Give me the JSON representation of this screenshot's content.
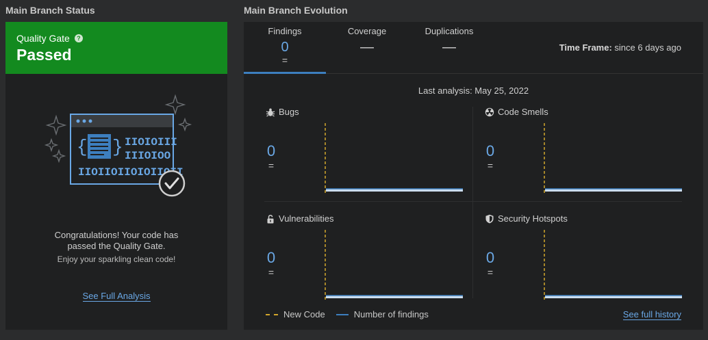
{
  "left": {
    "title": "Main Branch Status",
    "quality_gate_label": "Quality Gate",
    "help_glyph": "?",
    "status": "Passed",
    "status_color": "#138a1f",
    "congrats_line1": "Congratulations! Your code has",
    "congrats_line2": "passed the Quality Gate.",
    "enjoy": "Enjoy your sparkling clean code!",
    "see_full_analysis": "See Full Analysis"
  },
  "right": {
    "title": "Main Branch Evolution",
    "tabs": [
      {
        "label": "Findings",
        "value": "0",
        "eq": "=",
        "active": true
      },
      {
        "label": "Coverage",
        "value": "—",
        "active": false
      },
      {
        "label": "Duplications",
        "value": "—",
        "active": false
      }
    ],
    "timeframe_label": "Time Frame:",
    "timeframe_value": "since 6 days ago",
    "last_analysis": "Last analysis: May 25, 2022",
    "metrics": [
      {
        "name": "Bugs",
        "icon": "bug-icon",
        "value": "0",
        "eq": "="
      },
      {
        "name": "Code Smells",
        "icon": "code-smell-icon",
        "value": "0",
        "eq": "="
      },
      {
        "name": "Vulnerabilities",
        "icon": "lock-icon",
        "value": "0",
        "eq": "="
      },
      {
        "name": "Security Hotspots",
        "icon": "shield-icon",
        "value": "0",
        "eq": "="
      }
    ],
    "legend": {
      "new_code": "New Code",
      "findings": "Number of findings"
    },
    "see_full_history": "See full history"
  },
  "colors": {
    "accent_blue": "#6aa8e6",
    "new_code_line": "#d4a72c",
    "findings_line": "#3d7fbf"
  }
}
